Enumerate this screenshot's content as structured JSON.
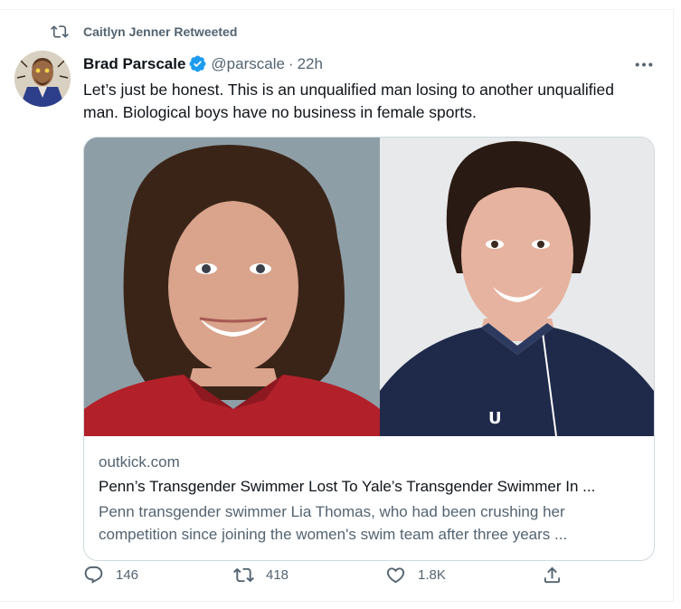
{
  "social_context": {
    "text": "Caitlyn Jenner Retweeted"
  },
  "tweet": {
    "display_name": "Brad Parscale",
    "handle": "@parscale",
    "separator": "·",
    "time": "22h",
    "text": "Let’s just be honest. This is an unqualified man losing to another unqualified man. Biological boys have no business in female sports."
  },
  "card": {
    "domain": "outkick.com",
    "title": "Penn’s Transgender Swimmer Lost To Yale’s Transgender Swimmer In ...",
    "description": "Penn transgender swimmer Lia Thomas, who had been crushing her competition since joining the women's swim team after three years ..."
  },
  "actions": {
    "replies": "146",
    "retweets": "418",
    "likes": "1.8K"
  },
  "colors": {
    "text_primary": "#0f1419",
    "text_secondary": "#536471",
    "verified_badge": "#1d9bf0",
    "border": "#cfd9de"
  },
  "icons": [
    "retweet-icon",
    "verified-badge-icon",
    "more-icon",
    "reply-icon",
    "like-icon",
    "share-icon"
  ]
}
